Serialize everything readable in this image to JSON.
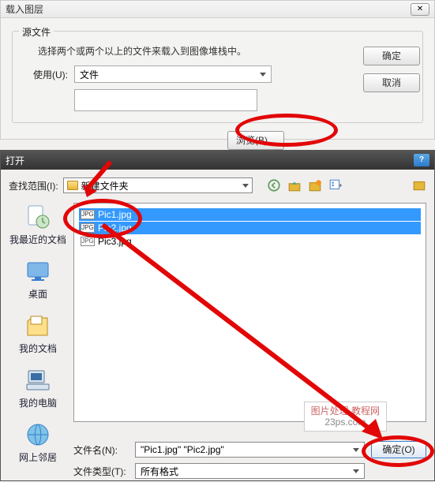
{
  "topDialog": {
    "title": "载入图层",
    "closeGlyph": "✕",
    "sourceLegend": "源文件",
    "instruction": "选择两个或两个以上的文件来载入到图像堆栈中。",
    "useLabel": "使用(U):",
    "useValue": "文件",
    "browseLabel": "浏览(B)...",
    "okLabel": "确定",
    "cancelLabel": "取消"
  },
  "openDialog": {
    "title": "打开",
    "helpGlyph": "?",
    "lookInLabel": "查找范围(I):",
    "lookInValue": "新建文件夹",
    "places": {
      "recent": "我最近的文档",
      "desktop": "桌面",
      "mydocs": "我的文档",
      "mycomputer": "我的电脑",
      "network": "网上邻居"
    },
    "files": [
      {
        "name": "Pic1.jpg",
        "selected": true
      },
      {
        "name": "Pic2.jpg",
        "selected": true
      },
      {
        "name": "Pic3.jpg",
        "selected": false
      }
    ],
    "fileNameLabel": "文件名(N):",
    "fileNameValue": "\"Pic1.jpg\" \"Pic2.jpg\"",
    "fileTypeLabel": "文件类型(T):",
    "fileTypeValue": "所有格式",
    "openBtn": "确定(O)"
  },
  "watermark": {
    "line1": "图片处理 教程网",
    "line2": "23ps.com"
  },
  "jpgTag": "JPG"
}
